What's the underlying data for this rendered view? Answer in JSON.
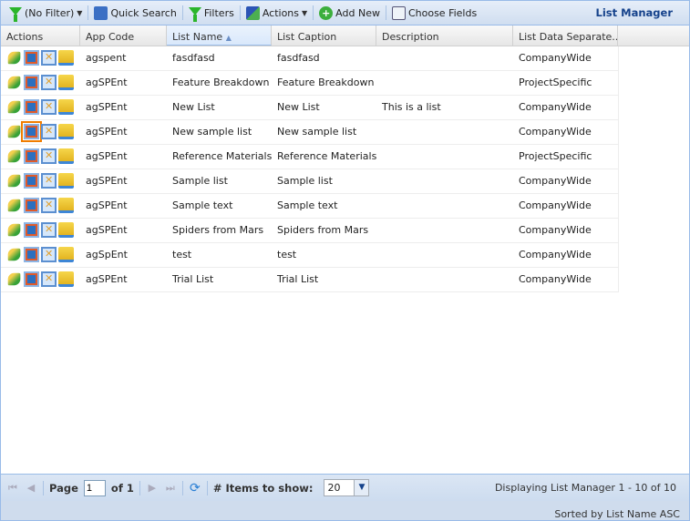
{
  "toolbar": {
    "filter": "(No Filter)",
    "quick_search": "Quick Search",
    "filters": "Filters",
    "actions": "Actions",
    "add_new": "Add New",
    "choose_fields": "Choose Fields",
    "title": "List Manager"
  },
  "columns": [
    "Actions",
    "App Code",
    "List Name",
    "List Caption",
    "Description",
    "List Data Separate..."
  ],
  "sort_indicator": "▲",
  "rows": [
    {
      "app": "agspent",
      "name": "fasdfasd",
      "caption": "fasdfasd",
      "desc": "",
      "sep": "CompanyWide"
    },
    {
      "app": "agSPEnt",
      "name": "Feature Breakdown",
      "caption": "Feature Breakdown",
      "desc": "",
      "sep": "ProjectSpecific"
    },
    {
      "app": "agSPEnt",
      "name": "New List",
      "caption": "New List",
      "desc": "This is a list",
      "sep": "CompanyWide"
    },
    {
      "app": "agSPEnt",
      "name": "New sample list",
      "caption": "New sample list",
      "desc": "",
      "sep": "CompanyWide"
    },
    {
      "app": "agSPEnt",
      "name": "Reference Materials",
      "caption": "Reference Materials",
      "desc": "",
      "sep": "ProjectSpecific"
    },
    {
      "app": "agSPEnt",
      "name": "Sample list",
      "caption": "Sample list",
      "desc": "",
      "sep": "CompanyWide"
    },
    {
      "app": "agSPEnt",
      "name": "Sample text",
      "caption": "Sample text",
      "desc": "",
      "sep": "CompanyWide"
    },
    {
      "app": "agSPEnt",
      "name": "Spiders from Mars",
      "caption": "Spiders from Mars",
      "desc": "",
      "sep": "CompanyWide"
    },
    {
      "app": "agSpEnt",
      "name": "test",
      "caption": "test",
      "desc": "",
      "sep": "CompanyWide"
    },
    {
      "app": "agSPEnt",
      "name": "Trial List",
      "caption": "Trial List",
      "desc": "",
      "sep": "CompanyWide"
    }
  ],
  "pager": {
    "page_label": "Page",
    "page": "1",
    "of": "of 1",
    "items_label": "# Items to show:",
    "items": "20",
    "display": "Displaying List Manager 1 - 10 of 10"
  },
  "status": "Sorted by List Name ASC"
}
